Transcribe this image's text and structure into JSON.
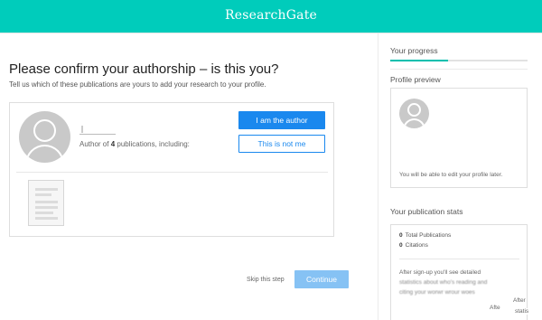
{
  "header": {
    "brand": "ResearchGate"
  },
  "main": {
    "title": "Please confirm your authorship – is this you?",
    "subtitle": "Tell us which of these publications are yours to add your research to your profile.",
    "card": {
      "author_prefix": "Author of ",
      "publication_count": "4",
      "author_suffix": " publications, including:",
      "confirm_button": "I am the author",
      "reject_button": "This is not me"
    },
    "skip_label": "Skip this step",
    "continue_label": "Continue"
  },
  "sidebar": {
    "progress": {
      "title": "Your progress",
      "fraction": 0.42,
      "accent": "#00bfae"
    },
    "preview": {
      "title": "Profile preview",
      "note": "You will be able to edit your profile later."
    },
    "stats": {
      "title": "Your publication stats",
      "items": [
        {
          "value": "0",
          "label": "Total Publications"
        },
        {
          "value": "0",
          "label": "Citations"
        }
      ],
      "description_line1": "After sign-up you'll see detailed",
      "description_line2": "statistics about who's reading and",
      "description_line3": "citing your worwr wrour woes",
      "ghost_text_1": "After",
      "ghost_text_2": "Afte",
      "ghost_text_3": "statis"
    }
  },
  "colors": {
    "header_bg": "#00ccbb",
    "primary": "#1a88ee",
    "continue_bg": "#86c2f4"
  },
  "icons": {
    "avatar": "user-avatar-icon",
    "document": "document-thumbnail-icon"
  }
}
